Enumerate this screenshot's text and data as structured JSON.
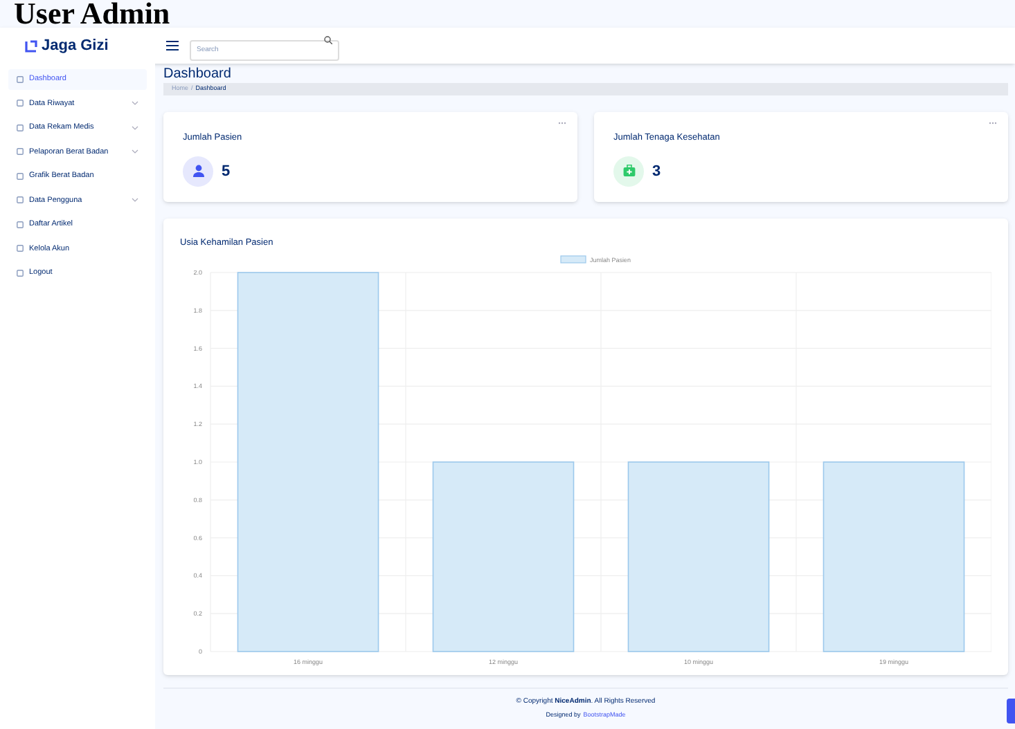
{
  "doc_heading": "User Admin",
  "header": {
    "brand": "Jaga Gizi",
    "search": {
      "placeholder": "Search"
    }
  },
  "sidebar": {
    "items": [
      {
        "label": "Dashboard",
        "kind": "link",
        "selected": true
      },
      {
        "label": "Data Riwayat",
        "kind": "group",
        "selected": false
      },
      {
        "label": "Data Rekam Medis",
        "kind": "group",
        "selected": false
      },
      {
        "label": "Pelaporan Berat Badan",
        "kind": "group",
        "selected": false
      },
      {
        "label": "Grafik Berat Badan",
        "kind": "link",
        "selected": false
      },
      {
        "label": "Data Pengguna",
        "kind": "group",
        "selected": false
      },
      {
        "label": "Daftar Artikel",
        "kind": "link",
        "selected": false
      },
      {
        "label": "Kelola Akun",
        "kind": "link",
        "selected": false
      },
      {
        "label": "Logout",
        "kind": "link",
        "selected": false
      }
    ]
  },
  "page": {
    "title": "Dashboard",
    "breadcrumb": [
      "Home",
      "Dashboard"
    ],
    "breadcrumb_separator": "/"
  },
  "cards": [
    {
      "title": "Jumlah Pasien",
      "value": "5",
      "kind": "person",
      "color": "#4154f1"
    },
    {
      "title": "Jumlah Tenaga Kesehatan",
      "value": "3",
      "kind": "medkit",
      "color": "#2eca6a"
    }
  ],
  "chart_card": {
    "title": "Usia Kehamilan Pasien",
    "chart_data": {
      "type": "bar",
      "categories": [
        "16 minggu",
        "12 minggu",
        "10 minggu",
        "19 minggu"
      ],
      "series": [
        {
          "name": "Jumlah Pasien",
          "color": "#d6eaf8",
          "values": [
            2,
            1,
            1,
            1
          ]
        }
      ],
      "grid": true,
      "ylim": [
        0,
        2
      ],
      "yticks": [
        {
          "value": 0,
          "label": "0"
        },
        {
          "value": 0.2,
          "label": "0.2"
        },
        {
          "value": 0.4,
          "label": "0.4"
        },
        {
          "value": 0.6,
          "label": "0.6"
        },
        {
          "value": 0.8,
          "label": "0.8"
        },
        {
          "value": 1,
          "label": "1.0"
        },
        {
          "value": 1.2,
          "label": "1.2"
        },
        {
          "value": 1.4,
          "label": "1.4"
        },
        {
          "value": 1.6,
          "label": "1.6"
        },
        {
          "value": 1.8,
          "label": "1.8"
        },
        {
          "value": 2,
          "label": "2.0"
        }
      ]
    }
  },
  "footer": {
    "copyright": "© Copyright **NiceAdmin**. All Rights Reserved",
    "designed_by": "Designed by",
    "designer": "BootstrapMade"
  }
}
